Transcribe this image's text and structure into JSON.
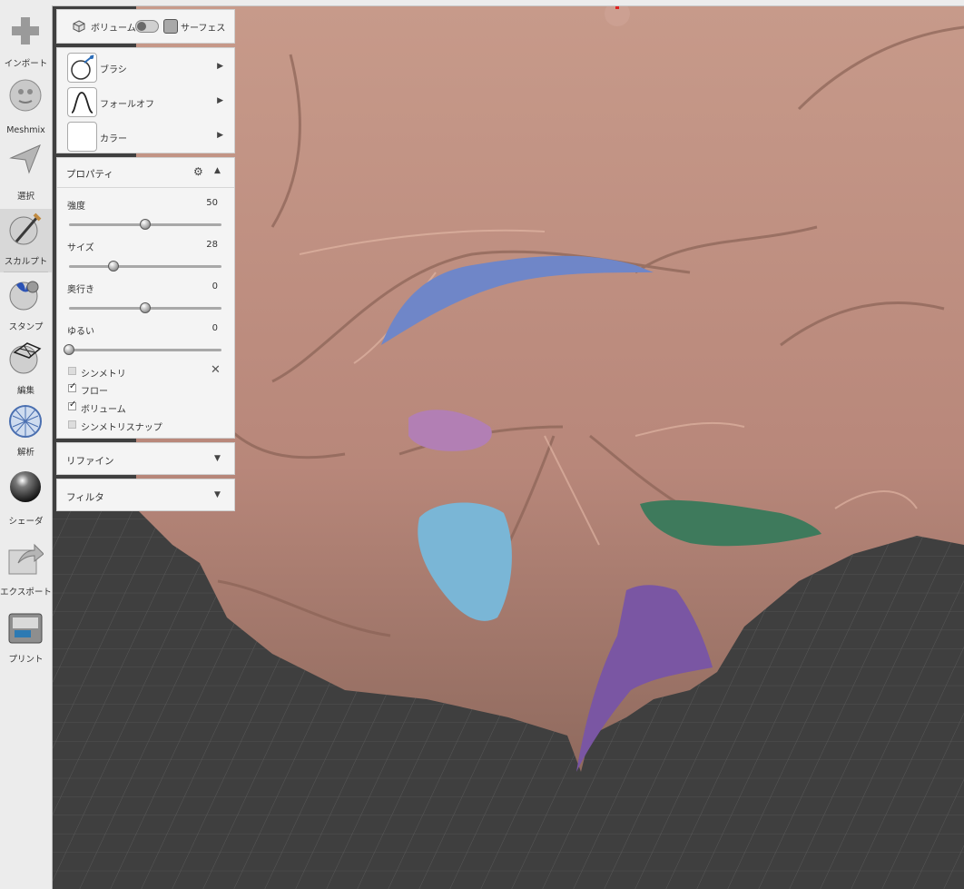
{
  "toolbar": {
    "items": [
      {
        "label": "インポート",
        "icon": "plus-icon"
      },
      {
        "label": "Meshmix",
        "icon": "meshmix-face-icon"
      },
      {
        "label": "選択",
        "icon": "select-arrow-icon"
      },
      {
        "label": "スカルプト",
        "icon": "sculpt-brush-icon"
      },
      {
        "label": "スタンプ",
        "icon": "stamp-icon"
      },
      {
        "label": "編集",
        "icon": "edit-icon"
      },
      {
        "label": "解析",
        "icon": "analysis-icon"
      },
      {
        "label": "シェーダ",
        "icon": "shader-icon"
      },
      {
        "label": "エクスポート",
        "icon": "export-icon"
      },
      {
        "label": "プリント",
        "icon": "print-icon"
      }
    ],
    "active": "スカルプト"
  },
  "mode_bar": {
    "volume_label": "ボリューム",
    "surface_label": "サーフェス"
  },
  "tool_sections": {
    "brush_label": "ブラシ",
    "falloff_label": "フォールオフ",
    "color_label": "カラー"
  },
  "properties": {
    "title": "プロパティ",
    "sliders": [
      {
        "label": "強度",
        "value": "50",
        "fraction": 0.5
      },
      {
        "label": "サイズ",
        "value": "28",
        "fraction": 0.29
      },
      {
        "label": "奥行き",
        "value": "0",
        "fraction": 0.5
      },
      {
        "label": "ゆるい",
        "value": "0",
        "fraction": 0.0
      }
    ],
    "checkboxes": [
      {
        "label": "シンメトリ",
        "checked": false,
        "enabled": false
      },
      {
        "label": "フロー",
        "checked": true,
        "enabled": true
      },
      {
        "label": "ボリューム",
        "checked": true,
        "enabled": true
      },
      {
        "label": "シンメトリスナップ",
        "checked": false,
        "enabled": false
      }
    ]
  },
  "collapsed_sections": {
    "refine_label": "リファイン",
    "filter_label": "フィルタ"
  },
  "colors": {
    "mesh": "#c1907f",
    "grid_background": "#3f3f3f",
    "paint_blue": "#6f86c8",
    "paint_pink": "#b27fb4",
    "paint_lightblue": "#7ab6d6",
    "paint_green": "#3e7a5c",
    "paint_purple": "#7a56a3"
  }
}
